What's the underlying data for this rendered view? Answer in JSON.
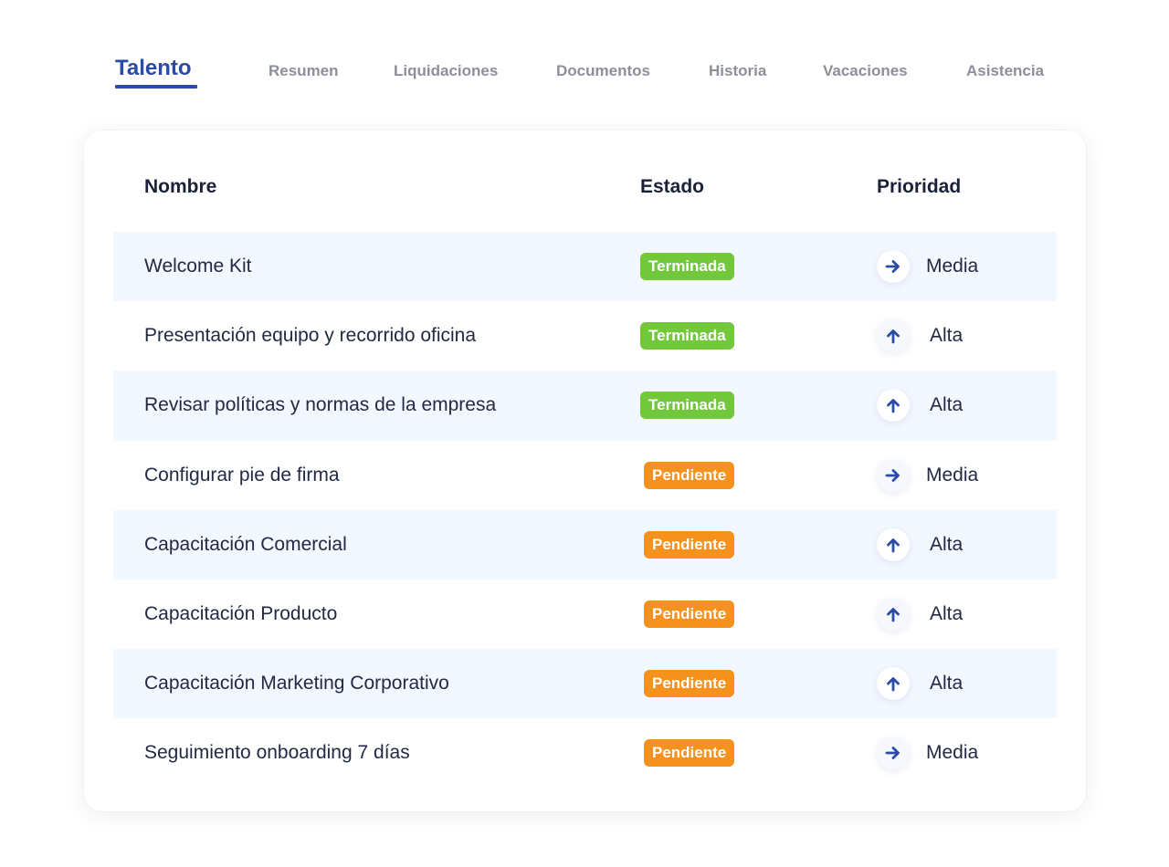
{
  "tabs": [
    {
      "label": "Talento",
      "active": true
    },
    {
      "label": "Resumen",
      "active": false
    },
    {
      "label": "Liquidaciones",
      "active": false
    },
    {
      "label": "Documentos",
      "active": false
    },
    {
      "label": "Historia",
      "active": false
    },
    {
      "label": "Vacaciones",
      "active": false
    },
    {
      "label": "Asistencia",
      "active": false
    }
  ],
  "table": {
    "columns": {
      "name": "Nombre",
      "status": "Estado",
      "priority": "Prioridad"
    },
    "rows": [
      {
        "name": "Welcome Kit",
        "status": "Terminada",
        "priority": "Media",
        "priority_icon": "arrow-right-icon"
      },
      {
        "name": "Presentación equipo y recorrido oficina",
        "status": "Terminada",
        "priority": "Alta",
        "priority_icon": "arrow-up-icon"
      },
      {
        "name": "Revisar políticas y normas de la empresa",
        "status": "Terminada",
        "priority": "Alta",
        "priority_icon": "arrow-up-icon"
      },
      {
        "name": "Configurar pie de firma",
        "status": "Pendiente",
        "priority": "Media",
        "priority_icon": "arrow-right-icon"
      },
      {
        "name": "Capacitación Comercial",
        "status": "Pendiente",
        "priority": "Alta",
        "priority_icon": "arrow-up-icon"
      },
      {
        "name": "Capacitación Producto",
        "status": "Pendiente",
        "priority": "Alta",
        "priority_icon": "arrow-up-icon"
      },
      {
        "name": "Capacitación Marketing Corporativo",
        "status": "Pendiente",
        "priority": "Alta",
        "priority_icon": "arrow-up-icon"
      },
      {
        "name": "Seguimiento onboarding 7 días",
        "status": "Pendiente",
        "priority": "Media",
        "priority_icon": "arrow-right-icon"
      }
    ]
  },
  "colors": {
    "accent": "#2b4ba8",
    "status_done": "#72c73a",
    "status_pending": "#f5921e",
    "row_stripe": "#f3f7ff",
    "tab_inactive": "#8d8f99"
  }
}
